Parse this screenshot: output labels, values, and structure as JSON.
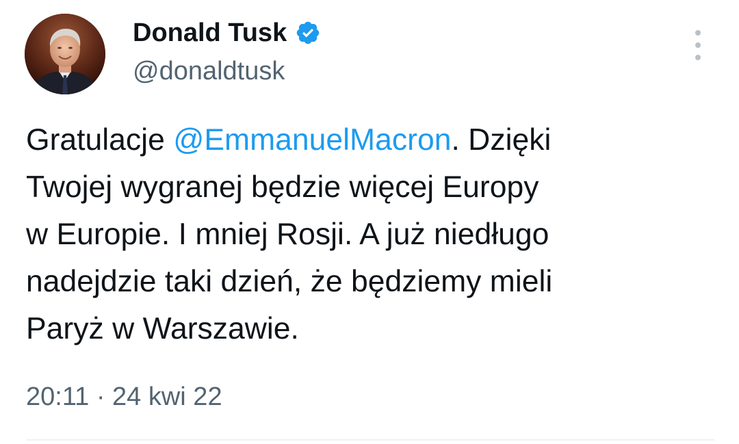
{
  "author": {
    "display_name": "Donald Tusk",
    "handle": "@donaldtusk",
    "verified_icon": "verified-badge-icon",
    "avatar_icon": "profile-photo"
  },
  "more_icon": "more-vertical-icon",
  "tweet": {
    "line1_before": "Gratulacje ",
    "line1_mention": "@EmmanuelMacron",
    "line1_after": ". Dzięki",
    "line2": "Twojej wygranej będzie więcej Europy",
    "line3": "w Europie. I mniej Rosji. A już niedługo",
    "line4": "nadejdzie taki dzień, że będziemy mieli",
    "line5": "Paryż w Warszawie."
  },
  "timestamp": "20:11 · 24 kwi 22",
  "colors": {
    "mention": "#1d9bf0",
    "secondary_text": "#536471",
    "verified": "#1d9bf0"
  }
}
